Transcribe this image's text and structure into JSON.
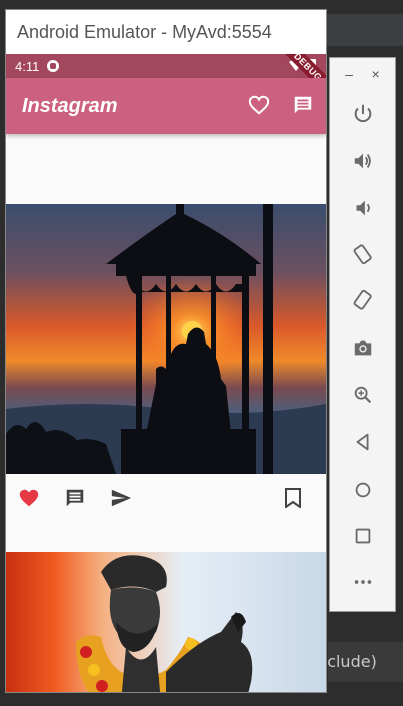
{
  "window": {
    "title": "Android Emulator - MyAvd:5554"
  },
  "status_bar": {
    "time": "4:11",
    "debug_banner": "DEBUG"
  },
  "app_bar": {
    "title": "Instagram",
    "icons": [
      "heart-outline-icon",
      "message-icon"
    ]
  },
  "posts": [
    {
      "image": "sunset-silhouette-statue",
      "liked": true,
      "actions": [
        "heart-filled-icon",
        "comment-icon",
        "send-icon"
      ],
      "bookmark": "bookmark-icon"
    },
    {
      "image": "statue-with-marigold-garland"
    }
  ],
  "side_panel": {
    "window_controls": [
      "minimize",
      "close"
    ],
    "minimize_glyph": "–",
    "close_glyph": "×",
    "buttons": [
      "power-icon",
      "volume-up-icon",
      "volume-down-icon",
      "rotate-left-icon",
      "rotate-right-icon",
      "camera-icon",
      "zoom-icon",
      "back-icon",
      "home-icon",
      "overview-icon",
      "more-icon"
    ]
  },
  "background": {
    "partial_text": "xclude)"
  },
  "colors": {
    "appbar": "#cc6080",
    "statusbar": "#a3475e",
    "like": "#e53945"
  }
}
